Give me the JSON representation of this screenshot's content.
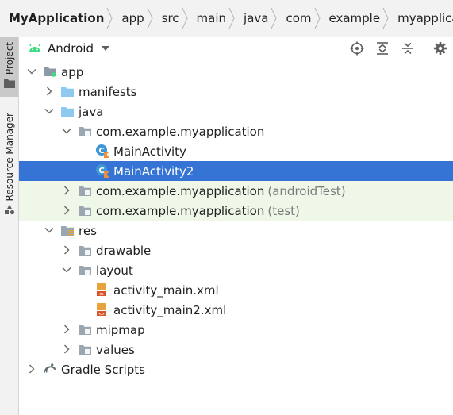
{
  "breadcrumb": [
    "MyApplication",
    "app",
    "src",
    "main",
    "java",
    "com",
    "example",
    "myapplication"
  ],
  "stripe": {
    "project_label": "Project",
    "resource_manager_label": "Resource Manager"
  },
  "toolbar": {
    "view_label": "Android",
    "icons": [
      "locate-icon",
      "expand-all-icon",
      "collapse-all-icon",
      "settings-icon"
    ]
  },
  "tree": [
    {
      "label": "app",
      "suffix": "",
      "depth": 0,
      "expanded": true,
      "icon": "module-icon"
    },
    {
      "label": "manifests",
      "suffix": "",
      "depth": 1,
      "expanded": false,
      "icon": "folder-icon"
    },
    {
      "label": "java",
      "suffix": "",
      "depth": 1,
      "expanded": true,
      "icon": "folder-icon"
    },
    {
      "label": "com.example.myapplication",
      "suffix": "",
      "depth": 2,
      "expanded": true,
      "icon": "package-icon"
    },
    {
      "label": "MainActivity",
      "suffix": "",
      "depth": 3,
      "leaf": true,
      "icon": "kotlin-class-icon"
    },
    {
      "label": "MainActivity2",
      "suffix": "",
      "depth": 3,
      "leaf": true,
      "icon": "kotlin-class-icon",
      "selected": true
    },
    {
      "label": "com.example.myapplication",
      "suffix": "(androidTest)",
      "depth": 2,
      "expanded": false,
      "icon": "package-icon",
      "tinted": true
    },
    {
      "label": "com.example.myapplication",
      "suffix": "(test)",
      "depth": 2,
      "expanded": false,
      "icon": "package-icon",
      "tinted": true
    },
    {
      "label": "res",
      "suffix": "",
      "depth": 1,
      "expanded": true,
      "icon": "res-folder-icon"
    },
    {
      "label": "drawable",
      "suffix": "",
      "depth": 2,
      "expanded": false,
      "icon": "package-icon"
    },
    {
      "label": "layout",
      "suffix": "",
      "depth": 2,
      "expanded": true,
      "icon": "package-icon"
    },
    {
      "label": "activity_main.xml",
      "suffix": "",
      "depth": 3,
      "leaf": true,
      "icon": "xml-layout-icon"
    },
    {
      "label": "activity_main2.xml",
      "suffix": "",
      "depth": 3,
      "leaf": true,
      "icon": "xml-layout-icon"
    },
    {
      "label": "mipmap",
      "suffix": "",
      "depth": 2,
      "expanded": false,
      "icon": "package-icon"
    },
    {
      "label": "values",
      "suffix": "",
      "depth": 2,
      "expanded": false,
      "icon": "package-icon"
    },
    {
      "label": "Gradle Scripts",
      "suffix": "",
      "depth": 0,
      "expanded": false,
      "icon": "gradle-icon"
    }
  ],
  "colors": {
    "selection": "#3574d4",
    "tint": "#eef7e8",
    "folder": "#8ec9ef",
    "android_green": "#3ddc84"
  }
}
